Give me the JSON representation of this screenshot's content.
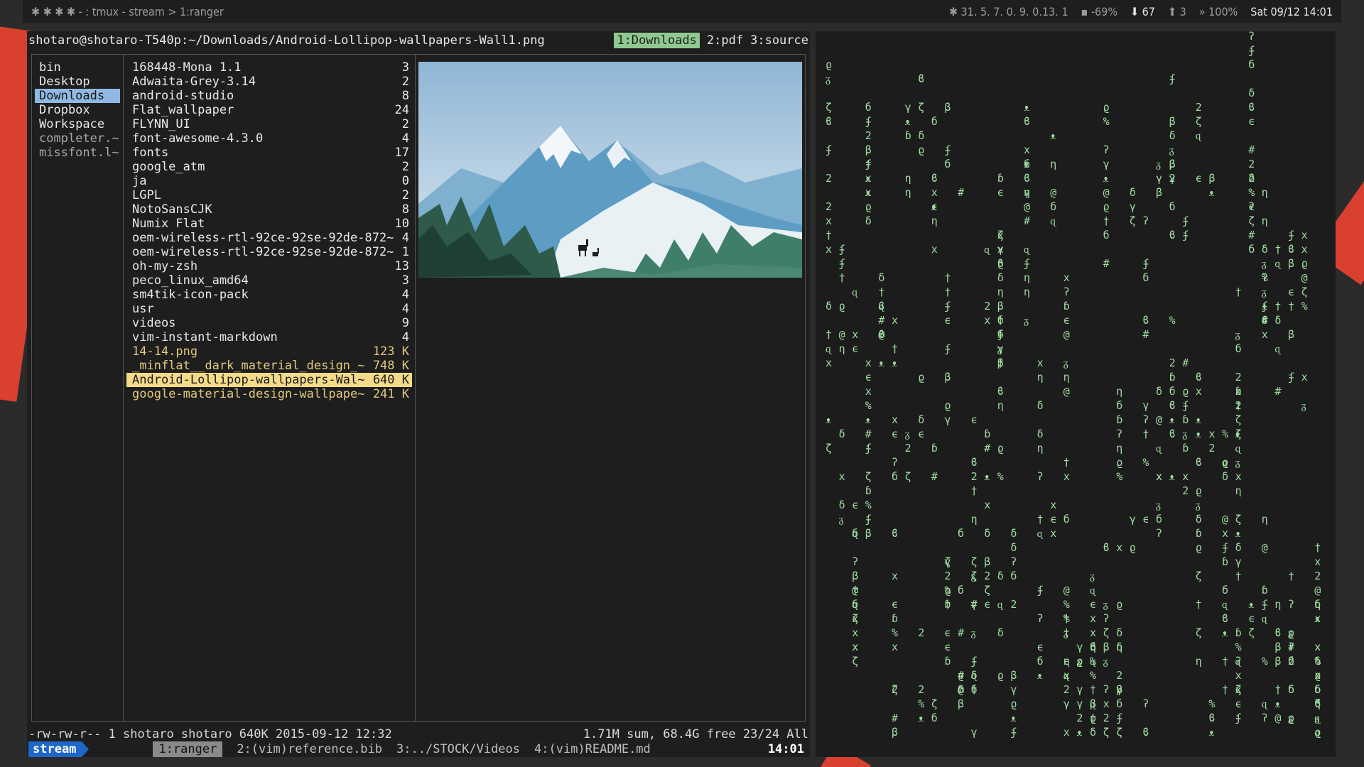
{
  "topbar": {
    "left": "✱ ✱ ✱ ✱ - : tmux - stream > 1:ranger",
    "cpu": "✱ 31. 5. 7. 0. 9. 0.13. 1",
    "battery": "▪ -69%",
    "down": "⬇ 67",
    "up": "⬆ 3",
    "volume": "» 100%",
    "datetime": "Sat 09/12 14:01"
  },
  "ranger": {
    "path": "shotaro@shotaro-T540p:~/Downloads/Android-Lollipop-wallpapers-Wall1.png",
    "tabs": [
      "1:Downloads",
      "2:pdf",
      "3:source"
    ],
    "parent_dirs": [
      {
        "name": "bin"
      },
      {
        "name": "Desktop"
      },
      {
        "name": "Downloads",
        "selected": true
      },
      {
        "name": "Dropbox"
      },
      {
        "name": "Workspace"
      },
      {
        "name": "completer.~",
        "grey": true
      },
      {
        "name": "missfont.l~",
        "grey": true
      }
    ],
    "entries": [
      {
        "name": "168448-Mona 1.1",
        "size": "3"
      },
      {
        "name": "Adwaita-Grey-3.14",
        "size": "2"
      },
      {
        "name": "android-studio",
        "size": "8"
      },
      {
        "name": "Flat_wallpaper",
        "size": "24"
      },
      {
        "name": "FLYNN_UI",
        "size": "2"
      },
      {
        "name": "font-awesome-4.3.0",
        "size": "4"
      },
      {
        "name": "fonts",
        "size": "17"
      },
      {
        "name": "google_atm",
        "size": "2"
      },
      {
        "name": "ja",
        "size": "0"
      },
      {
        "name": "LGPL",
        "size": "2"
      },
      {
        "name": "NotoSansCJK",
        "size": "8"
      },
      {
        "name": "Numix Flat",
        "size": "10"
      },
      {
        "name": "oem-wireless-rtl-92ce-92se-92de-872~",
        "size": "4"
      },
      {
        "name": "oem-wireless-rtl-92ce-92se-92de-872~",
        "size": "1"
      },
      {
        "name": "oh-my-zsh",
        "size": "13"
      },
      {
        "name": "peco_linux_amd64",
        "size": "3"
      },
      {
        "name": "sm4tik-icon-pack",
        "size": "4"
      },
      {
        "name": "usr",
        "size": "4"
      },
      {
        "name": "videos",
        "size": "9"
      },
      {
        "name": "vim-instant-markdown",
        "size": "4"
      },
      {
        "name": "14-14.png",
        "size": "123 K",
        "file": true
      },
      {
        "name": "_minflat__dark_material_design_~",
        "size": "748 K",
        "file": true
      },
      {
        "name": "Android-Lollipop-wallpapers-Wal~",
        "size": "640 K",
        "file": true,
        "selected": true
      },
      {
        "name": "google-material-design-wallpape~",
        "size": "241 K",
        "file": true
      }
    ],
    "status_left": "-rw-rw-r-- 1 shotaro shotaro 640K 2015-09-12 12:32",
    "status_right": "1.71M sum, 68.4G free  23/24  All"
  },
  "tmux": {
    "session": "stream",
    "windows": [
      {
        "label": "1:ranger",
        "active": true
      },
      {
        "label": "2:(vim)reference.bib"
      },
      {
        "label": "3:../STOCK/Videos"
      },
      {
        "label": "4:(vim)README.md"
      }
    ],
    "clock": "14:01"
  },
  "colors": {
    "accent_green": "#8fc98f",
    "dir_selected": "#8fb8e2",
    "file_color": "#e2c97a",
    "file_selected": "#f3db89",
    "session_blue": "#1e66c8",
    "matrix_green": "#9fdc9f",
    "wallpaper_red": "#d9402f"
  },
  "matrix_glyphs": "бxϱɋʔ†ϐ2ɓʄxᴥζ#δβγ%@ϵηᵹ"
}
